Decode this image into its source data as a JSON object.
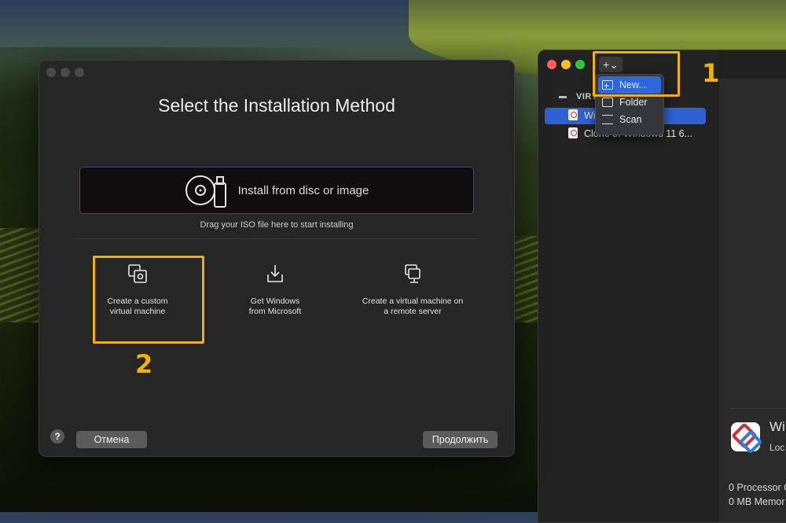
{
  "dialog": {
    "title": "Select the Installation Method",
    "drop_zone_label": "Install from disc or image",
    "drop_hint": "Drag your ISO file here to start installing",
    "options": [
      {
        "line1": "Create a custom",
        "line2": "virtual machine",
        "icon": "custom-vm-icon"
      },
      {
        "line1": "Get Windows",
        "line2": "from Microsoft",
        "icon": "download-icon"
      },
      {
        "line1": "Create a virtual machine on",
        "line2": "a remote server",
        "icon": "remote-server-icon"
      }
    ],
    "help_label": "?",
    "cancel_label": "Отмена",
    "continue_label": "Продолжить"
  },
  "annotations": {
    "step1": "1",
    "step2": "2",
    "highlight_color": "#f0b400"
  },
  "main_window": {
    "add_button_label": "+⌄",
    "section_header": "VIRT",
    "vm_list": [
      {
        "label": "Wi              it Arm",
        "selected": true
      },
      {
        "label": "Clone of Windows 11 6...",
        "selected": false
      }
    ],
    "add_menu": [
      {
        "label": "New...",
        "icon": "new-vm-icon",
        "active": true
      },
      {
        "label": "Folder",
        "icon": "folder-icon",
        "active": false
      },
      {
        "label": "Scan",
        "icon": "scan-icon",
        "active": false
      }
    ],
    "detail": {
      "app_name": "Wi",
      "app_sub": "Loc",
      "stat_cpu": "0 Processor C",
      "stat_mem": "0 MB Memor"
    }
  },
  "colors": {
    "accent": "#2f66dc",
    "dialog_bg": "#262626",
    "close": "#fe5f57",
    "minimize": "#febc2e",
    "zoom": "#28c840"
  }
}
